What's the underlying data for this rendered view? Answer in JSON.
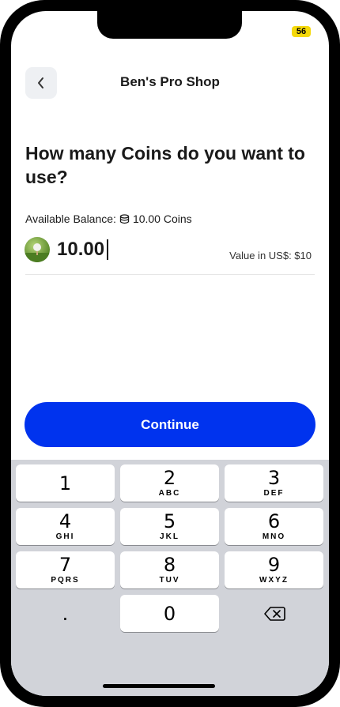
{
  "status_bar": {
    "battery": "56"
  },
  "header": {
    "title": "Ben's Pro Shop"
  },
  "question": "How many Coins do you want to use?",
  "balance": {
    "label": "Available Balance:",
    "value": "10.00 Coins"
  },
  "amount": {
    "value": "10.00",
    "usd_value": "Value in US$: $10"
  },
  "continue_label": "Continue",
  "keypad": {
    "keys": [
      {
        "digit": "1",
        "letters": ""
      },
      {
        "digit": "2",
        "letters": "ABC"
      },
      {
        "digit": "3",
        "letters": "DEF"
      },
      {
        "digit": "4",
        "letters": "GHI"
      },
      {
        "digit": "5",
        "letters": "JKL"
      },
      {
        "digit": "6",
        "letters": "MNO"
      },
      {
        "digit": "7",
        "letters": "PQRS"
      },
      {
        "digit": "8",
        "letters": "TUV"
      },
      {
        "digit": "9",
        "letters": "WXYZ"
      },
      {
        "digit": ".",
        "letters": ""
      },
      {
        "digit": "0",
        "letters": ""
      }
    ],
    "delete_icon": "backspace-icon"
  },
  "colors": {
    "accent": "#0033ee",
    "keyboard_bg": "#d1d3d9",
    "battery": "#f5d90a"
  }
}
